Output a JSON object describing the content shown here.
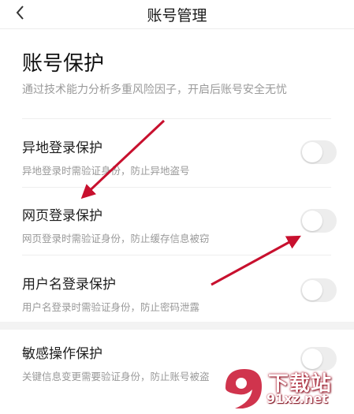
{
  "header": {
    "title": "账号管理",
    "back_icon": "chevron-left-icon"
  },
  "section": {
    "title": "账号保护",
    "description": "通过技术能力分析多重风险因子，开启后账号安全无忧"
  },
  "items": [
    {
      "label": "异地登录保护",
      "sub": "异地登录时需验证身份，防止异地盗号",
      "enabled": false
    },
    {
      "label": "网页登录保护",
      "sub": "网页登录时需验证身份，防止缓存信息被窃",
      "enabled": false
    },
    {
      "label": "用户名登录保护",
      "sub": "用户名登录时需验证身份，防止密码泄露",
      "enabled": false
    },
    {
      "label": "敏感操作保护",
      "sub": "关键信息变更需要验证身份，防止账号被盗",
      "enabled": false
    }
  ],
  "watermark": {
    "text": "下载站",
    "url": "91xz.net",
    "brand_color": "#c8102e"
  },
  "colors": {
    "annotation_arrow": "#c8102e",
    "toggle_off": "#ededed"
  }
}
